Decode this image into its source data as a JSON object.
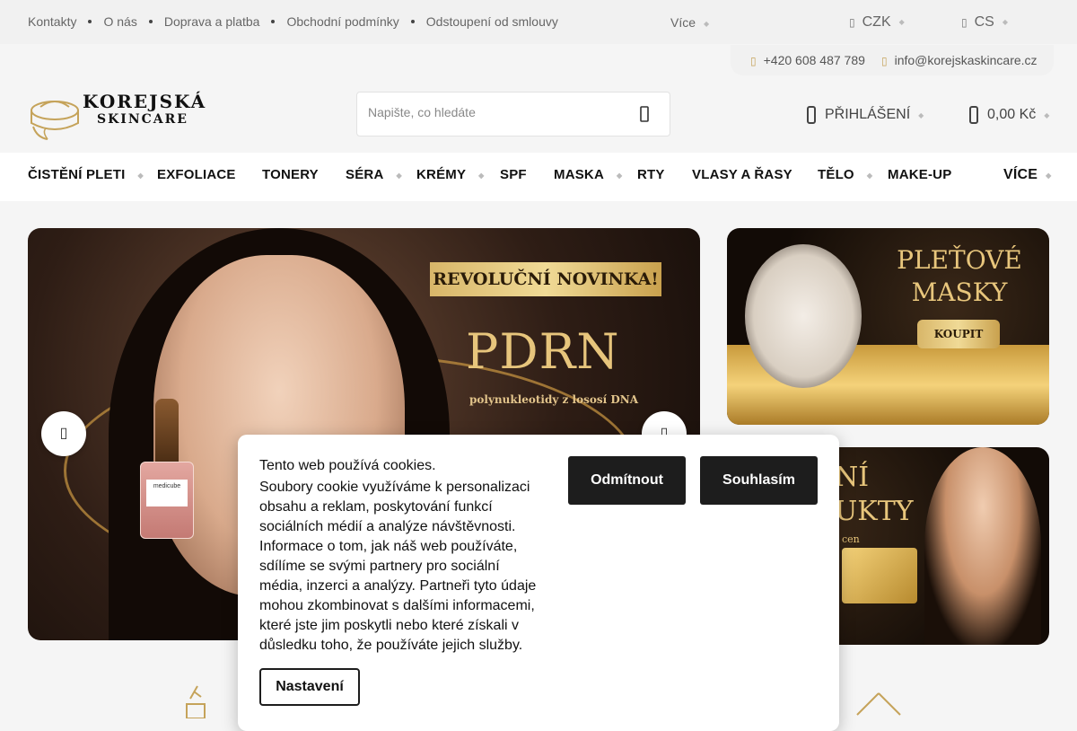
{
  "topbar": {
    "links": [
      "Kontakty",
      "O nás",
      "Doprava a platba",
      "Obchodní podmínky",
      "Odstoupení od smlouvy"
    ],
    "more": "Více",
    "currency": "CZK",
    "language": "CS"
  },
  "contact": {
    "phone": "+420 608 487 789",
    "email": "info@korejskaskincare.cz"
  },
  "logo": {
    "line1": "KOREJSKÁ",
    "line2": "SKINCARE"
  },
  "search": {
    "placeholder": "Napište, co hledáte"
  },
  "header": {
    "login": "PŘIHLÁŠENÍ",
    "cart_total": "0,00 Kč"
  },
  "nav": {
    "items": [
      "ČISTĚNÍ PLETI",
      "EXFOLIACE",
      "TONERY",
      "SÉRA",
      "KRÉMY",
      "SPF",
      "MASKA",
      "RTY",
      "VLASY A ŘASY",
      "TĚLO",
      "MAKE-UP"
    ],
    "more": "VÍCE"
  },
  "banner_main": {
    "tag": "REVOLUČNÍ NOVINKA!",
    "headline": "PDRN",
    "subline": "polynukleotidy z lososí DNA",
    "bottle_brand": "medicube"
  },
  "banner_side_1": {
    "title_line1": "PLEŤOVÉ",
    "title_line2": "MASKY",
    "button": "KOUPIT"
  },
  "banner_side_2": {
    "title_line1": "NÍ",
    "title_line2": "UKTY",
    "small": "cen"
  },
  "cookie": {
    "title": "Tento web používá cookies.",
    "text": "Soubory cookie využíváme k personalizaci obsahu a reklam, poskytování funkcí sociálních médií a analýze návštěvnosti. Informace o tom, jak náš web používáte, sdílíme se svými partnery pro sociální média, inzerci a analýzy. Partneři tyto údaje mohou zkombinovat s dalšími informacemi, které jste jim poskytli nebo které získali v důsledku toho, že používáte jejich služby.",
    "reject": "Odmítnout",
    "accept": "Souhlasím",
    "settings": "Nastavení"
  },
  "colors": {
    "accent_gold": "#c5a35a",
    "dark_button": "#1d1d1d"
  }
}
